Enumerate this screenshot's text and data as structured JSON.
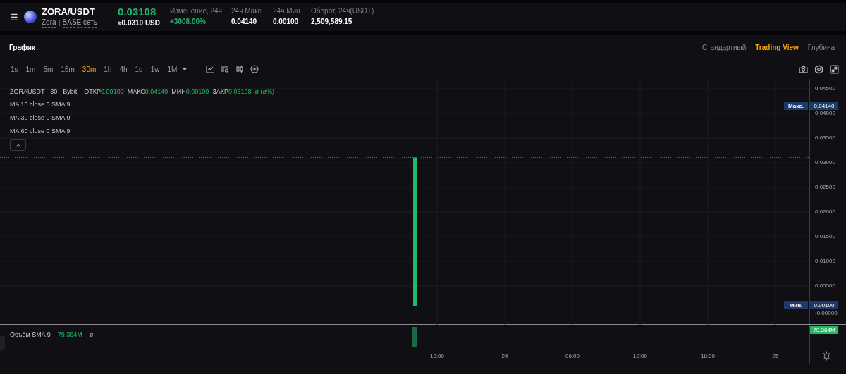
{
  "header": {
    "menu_icon": "☰",
    "pair": "ZORA/USDT",
    "coin": "Zora",
    "network": "BASE сеть",
    "price": "0.03108",
    "price_usd": "≈0.0310 USD",
    "stats": [
      {
        "label": "Изменение, 24ч",
        "value": "+3008.00%",
        "kind": "up"
      },
      {
        "label": "24ч Макс",
        "value": "0.04140",
        "kind": "plain"
      },
      {
        "label": "24ч Мин",
        "value": "0.00100",
        "kind": "plain"
      },
      {
        "label": "Оборот, 24ч(USDT)",
        "value": "2,509,589.15",
        "kind": "plain"
      }
    ]
  },
  "panel_title": "График",
  "view_tabs": [
    {
      "label": "Стандартный",
      "selected": false
    },
    {
      "label": "Trading View",
      "selected": true
    },
    {
      "label": "Глубина",
      "selected": false
    }
  ],
  "intervals": [
    {
      "label": "1s",
      "selected": false
    },
    {
      "label": "1m",
      "selected": false
    },
    {
      "label": "5m",
      "selected": false
    },
    {
      "label": "15m",
      "selected": false
    },
    {
      "label": "30m",
      "selected": true
    },
    {
      "label": "1h",
      "selected": false
    },
    {
      "label": "4h",
      "selected": false
    },
    {
      "label": "1d",
      "selected": false
    },
    {
      "label": "1w",
      "selected": false
    },
    {
      "label": "1M",
      "selected": false
    }
  ],
  "legend": {
    "symbol": "ZORAUSDT · 30 · Bybit",
    "ohlc": [
      {
        "label": "ОТКР",
        "value": "0.00100"
      },
      {
        "label": "МАКС",
        "value": "0.04140"
      },
      {
        "label": "МИН",
        "value": "0.00100"
      },
      {
        "label": "ЗАКР",
        "value": "0.03108"
      }
    ],
    "change": "ø (ø%)",
    "indicators": [
      "MA 10 close 0 SMA 9",
      "MA 30 close 0 SMA 9",
      "MA 60 close 0 SMA 9"
    ]
  },
  "price_axis": [
    "0.04500",
    "0.04000",
    "0.03500",
    "0.03000",
    "0.02500",
    "0.02000",
    "0.01500",
    "0.01000",
    "0.00500",
    "-0.00000"
  ],
  "max_marker": {
    "tag": "Макс.",
    "value": "0.04140"
  },
  "min_marker": {
    "tag": "Мин.",
    "value": "0.00100"
  },
  "volume": {
    "label": "Объём SMA 9",
    "value": "79.364M",
    "extra": "ø",
    "axis_value": "79.364M"
  },
  "time_axis": [
    "18:00",
    "24",
    "06:00",
    "12:00",
    "18:00",
    "25"
  ]
}
